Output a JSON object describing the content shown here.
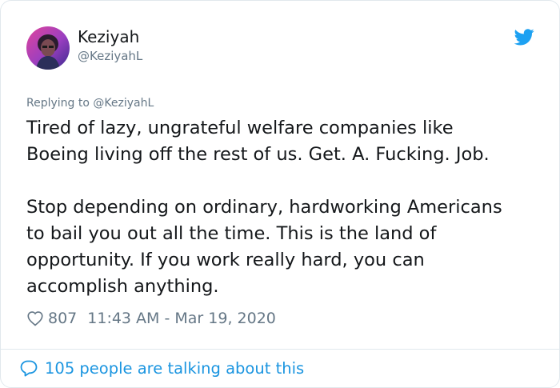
{
  "author": {
    "display_name": "Keziyah",
    "handle": "@KeziyahL",
    "avatar_icon": "profile-avatar"
  },
  "reply": {
    "prefix": "Replying to ",
    "mention": "@KeziyahL"
  },
  "tweet": {
    "paragraph_1": [
      "Tired of lazy, ungrateful welfare companies like",
      "Boeing living off the rest of us. Get. A. Fucking. Job."
    ],
    "paragraph_2": [
      "Stop depending on ordinary, hardworking Americans",
      "to bail you out all the time. This is the land of",
      "opportunity. If you work really hard, you can",
      "accomplish anything."
    ]
  },
  "meta": {
    "like_count": "807",
    "timestamp": "11:43 AM - Mar 19, 2020"
  },
  "conversation": {
    "label": "105 people are talking about this"
  },
  "icons": {
    "brand": "twitter-bird-icon",
    "like": "heart-icon",
    "reply": "speech-bubble-icon"
  },
  "colors": {
    "brand_blue": "#1da1f2",
    "link_blue": "#1b95e0",
    "secondary_text": "#657786",
    "primary_text": "#14171a",
    "border": "#e1e8ed"
  }
}
